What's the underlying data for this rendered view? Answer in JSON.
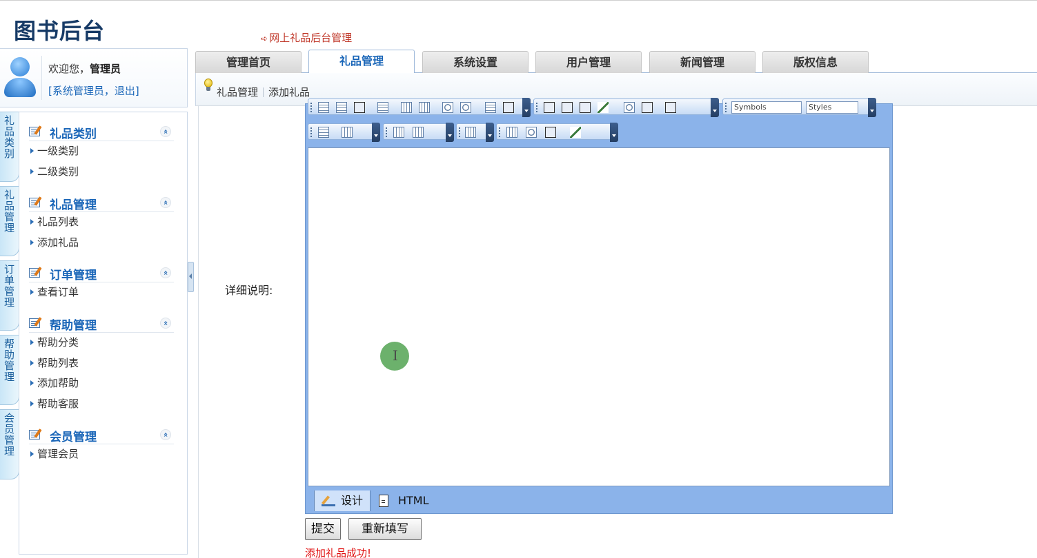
{
  "header": {
    "logo": "图书后台",
    "subtitle_arrow": "➪",
    "subtitle": "网上礼品后台管理"
  },
  "user": {
    "welcome_prefix": "欢迎您，",
    "name": "管理员",
    "role_line": "[系统管理员，退出]"
  },
  "tabs": [
    {
      "label": "管理首页"
    },
    {
      "label": "礼品管理"
    },
    {
      "label": "系统设置"
    },
    {
      "label": "用户管理"
    },
    {
      "label": "新闻管理"
    },
    {
      "label": "版权信息"
    }
  ],
  "active_tab": "礼品管理",
  "breadcrumb": [
    "礼品管理",
    "添加礼品"
  ],
  "vertical_tabs": [
    "礼品类别",
    "礼品管理",
    "订单管理",
    "帮助管理",
    "会员管理"
  ],
  "menu": [
    {
      "title": "礼品类别",
      "items": [
        "一级类别",
        "二级类别"
      ]
    },
    {
      "title": "礼品管理",
      "items": [
        "礼品列表",
        "添加礼品"
      ]
    },
    {
      "title": "订单管理",
      "items": [
        "查看订单"
      ]
    },
    {
      "title": "帮助管理",
      "items": [
        "帮助分类",
        "帮助列表",
        "添加帮助",
        "帮助客服"
      ]
    },
    {
      "title": "会员管理",
      "items": [
        "管理会员"
      ]
    }
  ],
  "collapse_glyph": "«",
  "form": {
    "detail_label": "详细说明:"
  },
  "editor": {
    "symbols_select": "Symbols",
    "styles_select": "Styles",
    "mode_design": "设计",
    "mode_html": "HTML",
    "content": ""
  },
  "buttons": {
    "submit": "提交",
    "reset": "重新填写"
  },
  "status_message": "添加礼品成功!",
  "colors": {
    "accent": "#1a66b8",
    "editor_frame": "#8bb3ea",
    "success_text": "#e01010"
  }
}
